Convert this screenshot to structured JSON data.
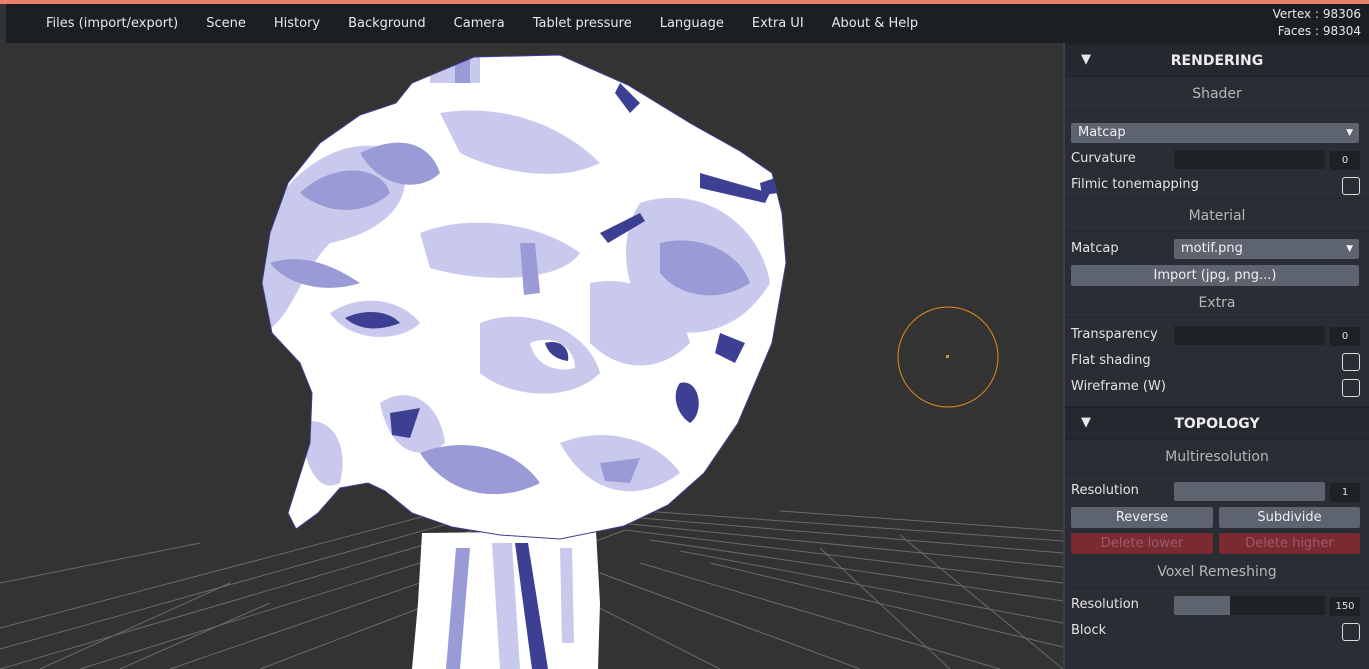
{
  "menu": {
    "items": [
      {
        "label": "Files (import/export)"
      },
      {
        "label": "Scene"
      },
      {
        "label": "History"
      },
      {
        "label": "Background"
      },
      {
        "label": "Camera"
      },
      {
        "label": "Tablet pressure"
      },
      {
        "label": "Language"
      },
      {
        "label": "Extra UI"
      },
      {
        "label": "About & Help"
      }
    ]
  },
  "stats": {
    "vertex": "Vertex : 98306",
    "faces": "Faces : 98304"
  },
  "colors": {
    "accent": "#e8806a",
    "brush_cursor": "#e08a20",
    "mesh_white": "#ffffff",
    "mesh_light": "#c9c9ee",
    "mesh_mid": "#9a9bd6",
    "mesh_dark": "#3d3f93",
    "danger": "#7a2a33"
  },
  "panel": {
    "rendering": {
      "title": "RENDERING",
      "shader": {
        "heading": "Shader",
        "shader_select": "Matcap",
        "curvature_label": "Curvature",
        "curvature_value": "0",
        "curvature_level": 0,
        "filmic_label": "Filmic tonemapping",
        "filmic_checked": false
      },
      "material": {
        "heading": "Material",
        "matcap_label": "Matcap",
        "matcap_select": "motif.png",
        "import_button": "Import (jpg, png...)"
      },
      "extra": {
        "heading": "Extra",
        "transparency_label": "Transparency",
        "transparency_value": "0",
        "transparency_level": 0,
        "flat_label": "Flat shading",
        "flat_checked": false,
        "wireframe_label": "Wireframe (W)",
        "wireframe_checked": false
      }
    },
    "topology": {
      "title": "TOPOLOGY",
      "multires": {
        "heading": "Multiresolution",
        "resolution_label": "Resolution",
        "resolution_value": "1",
        "resolution_level": 1,
        "reverse_button": "Reverse",
        "subdivide_button": "Subdivide",
        "delete_lower_button": "Delete lower",
        "delete_higher_button": "Delete higher"
      },
      "voxel": {
        "heading": "Voxel Remeshing",
        "resolution_label": "Resolution",
        "resolution_value": "150",
        "resolution_level": 0.37,
        "block_label": "Block",
        "block_checked": false
      }
    }
  }
}
